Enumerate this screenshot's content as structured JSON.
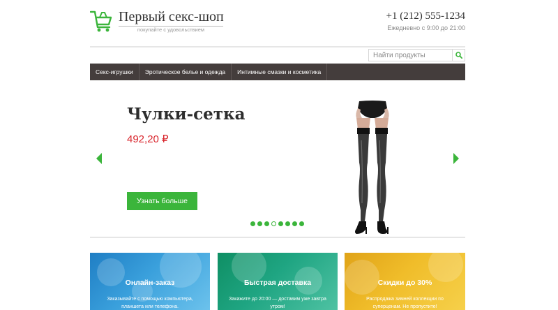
{
  "header": {
    "logo_title": "Первый секс-шоп",
    "logo_tagline": "покупайте с удовольствием",
    "logo_icon": "shopping-cart-icon",
    "phone": "+1 (212) 555-1234",
    "hours": "Ежедневно с 9:00 до 21:00"
  },
  "search": {
    "placeholder": "Найти продукты",
    "icon": "search-icon"
  },
  "nav": {
    "items": [
      {
        "label": "Секс-игрушки"
      },
      {
        "label": "Эротическое белье и одежда"
      },
      {
        "label": "Интимные смазки и косметика"
      }
    ]
  },
  "slider": {
    "title": "Чулки-сетка",
    "price": "492,20 ₽",
    "button_label": "Узнать больше",
    "dots_count": 8,
    "active_dot": 3
  },
  "features": [
    {
      "title": "Онлайн-заказ",
      "text": "Заказывайте с помощью компьютера, планшета или телефона."
    },
    {
      "title": "Быстрая доставка",
      "text": "Закажите до 20:00 — доставим уже завтра утром!"
    },
    {
      "title": "Скидки до 30%",
      "text": "Распродажа зимней коллекции по суперценам. Не пропустите!"
    }
  ],
  "colors": {
    "accent": "#3bb53b",
    "nav_bg": "#443d3c",
    "price": "#d9272e"
  }
}
